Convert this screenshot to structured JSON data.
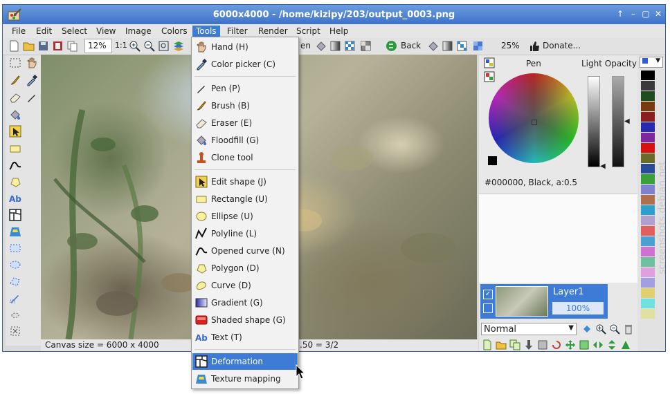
{
  "window": {
    "title": "6000x4000 - /home/kizipy/203/output_0003.png"
  },
  "menubar": {
    "items": [
      "File",
      "Edit",
      "Select",
      "View",
      "Image",
      "Colors",
      "Tools",
      "Filter",
      "Render",
      "Script",
      "Help"
    ]
  },
  "toolbar": {
    "zoom": "12%",
    "zoom_1to1": "1:1",
    "pen_text_partial": "en",
    "back_label": "Back",
    "zoom2": "25%",
    "donate_label": "Donate..."
  },
  "tools_menu": {
    "items": [
      {
        "label": "Hand (H)",
        "icon": "hand-icon"
      },
      {
        "label": "Color picker (C)",
        "icon": "color-picker-icon"
      },
      {
        "label": "Pen (P)",
        "icon": "pen-icon"
      },
      {
        "label": "Brush (B)",
        "icon": "brush-icon"
      },
      {
        "label": "Eraser (E)",
        "icon": "eraser-icon"
      },
      {
        "label": "Floodfill (G)",
        "icon": "floodfill-icon"
      },
      {
        "label": "Clone tool",
        "icon": "clone-icon"
      },
      {
        "label": "Edit shape (J)",
        "icon": "edit-shape-icon"
      },
      {
        "label": "Rectangle (U)",
        "icon": "rectangle-icon"
      },
      {
        "label": "Ellipse (U)",
        "icon": "ellipse-icon"
      },
      {
        "label": "Polyline (L)",
        "icon": "polyline-icon"
      },
      {
        "label": "Opened curve (N)",
        "icon": "opened-curve-icon"
      },
      {
        "label": "Polygon (D)",
        "icon": "polygon-icon"
      },
      {
        "label": "Curve (D)",
        "icon": "curve-icon"
      },
      {
        "label": "Gradient (G)",
        "icon": "gradient-icon"
      },
      {
        "label": "Shaded shape (G)",
        "icon": "shaded-shape-icon"
      },
      {
        "label": "Text (T)",
        "icon": "text-icon"
      },
      {
        "label": "Deformation",
        "icon": "deformation-icon"
      },
      {
        "label": "Texture mapping",
        "icon": "texture-mapping-icon"
      }
    ]
  },
  "status": {
    "canvas_size": "Canvas size = 6000 x 4000",
    "ratio_partial": ".50 = 3/2"
  },
  "color_panel": {
    "pen_label": "Pen",
    "light_opacity_label": "Light Opacity",
    "color_value": "#000000, Black, a:0.5"
  },
  "layers": {
    "name": "Layer1",
    "opacity": "100%",
    "blend_mode": "Normal"
  },
  "watermark": "screenshots.debian.net",
  "colors": {
    "accent": "#3d7bd6",
    "title_bar": "#4a7fd0",
    "selected_swatch": "#000000"
  },
  "palette": [
    "#000000",
    "#3a3a3a",
    "#1f4d1f",
    "#7a3a10",
    "#8a1f1f",
    "#2a2ab0",
    "#7a2a9a",
    "#d81010",
    "#6a6a2a",
    "#2a4a9a",
    "#3aa03a",
    "#8080d0",
    "#b07050",
    "#2f9fd0",
    "#b0a0d0",
    "#e06060",
    "#4aa0d0",
    "#d070d0",
    "#70c0a0",
    "#e0a0e0",
    "#a0a0e0",
    "#e0d070",
    "#70e0e0",
    "#e0e0a0"
  ]
}
